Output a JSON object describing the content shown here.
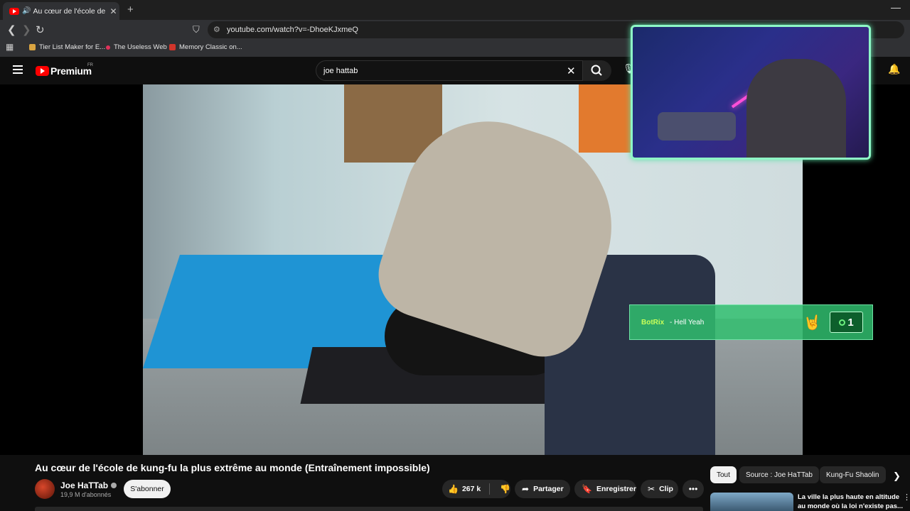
{
  "browser": {
    "tab_title": "Au cœur de l'école de kung-fu",
    "new_tab": "+",
    "url": "youtube.com/watch?v=-DhoeKJxmeQ",
    "bookmarks": [
      {
        "label": "Tier List Maker for E...",
        "color": "#d9a441"
      },
      {
        "label": "The Useless Web",
        "color": "#e0325a"
      },
      {
        "label": "Memory Classic on...",
        "color": "#d1352b"
      }
    ]
  },
  "masthead": {
    "logo": "Premium",
    "region": "FR",
    "search_value": "joe hattab"
  },
  "overlay": {
    "alert_name": "BotRix",
    "alert_message": "- Hell Yeah",
    "alert_count": "1"
  },
  "video": {
    "title": "Au cœur de l'école de kung-fu la plus extrême au monde (Entraînement impossible)",
    "channel": "Joe HaTTab",
    "subscribers": "19,9 M d'abonnés",
    "subscribe_label": "S'abonner",
    "likes": "267 k",
    "share_label": "Partager",
    "save_label": "Enregistrer",
    "clip_label": "Clip"
  },
  "chips": [
    "Tout",
    "Source : Joe HaTTab",
    "Kung-Fu Shaolin"
  ],
  "recommended": {
    "title": "La ville la plus haute en altitude au monde où la loi n'existe pas..."
  },
  "colors": {
    "yt_red": "#ff0000",
    "cam_border": "#8ef7c6",
    "alert_bg": "#30be6e"
  }
}
